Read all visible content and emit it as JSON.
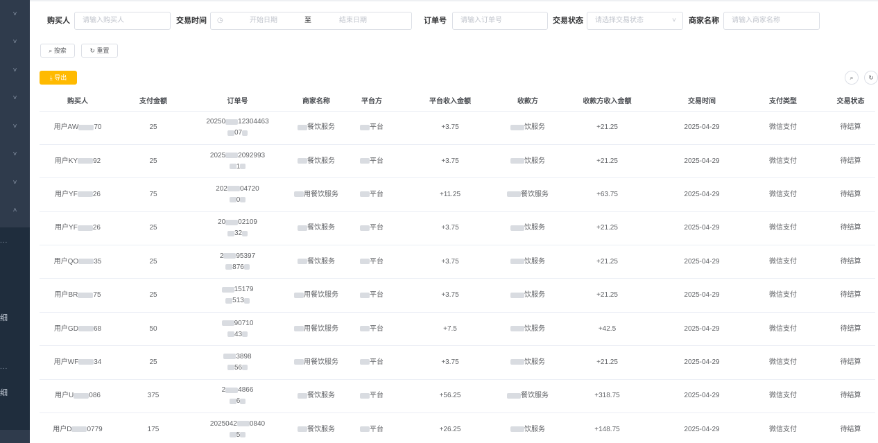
{
  "sidebar": {
    "chevron": "˅",
    "chevron_up": "˄",
    "dots": "...",
    "label_a": "细",
    "label_b": "细"
  },
  "filters": {
    "buyer_label": "购买人",
    "buyer_placeholder": "请输入购买人",
    "time_label": "交易时间",
    "start_placeholder": "开始日期",
    "range_sep": "至",
    "end_placeholder": "结束日期",
    "order_label": "订单号",
    "order_placeholder": "请输入订单号",
    "status_label": "交易状态",
    "status_placeholder": "请选择交易状态",
    "merchant_label": "商家名称",
    "merchant_placeholder": "请输入商家名称"
  },
  "actions": {
    "search": "搜索",
    "reset": "重置",
    "export": "导出"
  },
  "table": {
    "columns": [
      "购买人",
      "支付金额",
      "订单号",
      "商家名称",
      "平台方",
      "平台收入金额",
      "收款方",
      "收款方收入金额",
      "交易时间",
      "支付类型",
      "交易状态"
    ],
    "rows": [
      {
        "buyer_a": "用户AW",
        "buyer_b": "70",
        "amount": "25",
        "order_a": "20250",
        "order_b": "12304463",
        "order_c": "07",
        "merchant": "餐饮服务",
        "platform_a": "",
        "platform_b": "平台",
        "platform_income": "+3.75",
        "payee": "饮服务",
        "payee_income": "+21.25",
        "time": "2025-04-29",
        "pay_type": "微信支付",
        "status": "待结算"
      },
      {
        "buyer_a": "用户KY",
        "buyer_b": "92",
        "amount": "25",
        "order_a": "2025",
        "order_b": "2092993",
        "order_c": "1",
        "merchant": "餐饮服务",
        "platform_a": "",
        "platform_b": "平台",
        "platform_income": "+3.75",
        "payee": "饮服务",
        "payee_income": "+21.25",
        "time": "2025-04-29",
        "pay_type": "微信支付",
        "status": "待结算"
      },
      {
        "buyer_a": "用户YF",
        "buyer_b": "26",
        "amount": "75",
        "order_a": "202",
        "order_b": "04720",
        "order_c": "0",
        "merchant": "用餐饮服务",
        "platform_a": "",
        "platform_b": "平台",
        "platform_income": "+11.25",
        "payee": "餐饮服务",
        "payee_income": "+63.75",
        "time": "2025-04-29",
        "pay_type": "微信支付",
        "status": "待结算"
      },
      {
        "buyer_a": "用户YF",
        "buyer_b": "26",
        "amount": "25",
        "order_a": "20",
        "order_b": "02109",
        "order_c": "32",
        "merchant": "餐饮服务",
        "platform_a": "",
        "platform_b": "平台",
        "platform_income": "+3.75",
        "payee": "饮服务",
        "payee_income": "+21.25",
        "time": "2025-04-29",
        "pay_type": "微信支付",
        "status": "待结算"
      },
      {
        "buyer_a": "用户QO",
        "buyer_b": "35",
        "amount": "25",
        "order_a": "2",
        "order_b": "95397",
        "order_c": "876",
        "merchant": "餐饮服务",
        "platform_a": "",
        "platform_b": "平台",
        "platform_income": "+3.75",
        "payee": "饮服务",
        "payee_income": "+21.25",
        "time": "2025-04-29",
        "pay_type": "微信支付",
        "status": "待结算"
      },
      {
        "buyer_a": "用户BR",
        "buyer_b": "75",
        "amount": "25",
        "order_a": "",
        "order_b": "15179",
        "order_c": "513",
        "merchant": "用餐饮服务",
        "platform_a": "",
        "platform_b": "平台",
        "platform_income": "+3.75",
        "payee": "饮服务",
        "payee_income": "+21.25",
        "time": "2025-04-29",
        "pay_type": "微信支付",
        "status": "待结算"
      },
      {
        "buyer_a": "用户GD",
        "buyer_b": "68",
        "amount": "50",
        "order_a": "",
        "order_b": "90710",
        "order_c": "43",
        "merchant": "用餐饮服务",
        "platform_a": "",
        "platform_b": "平台",
        "platform_income": "+7.5",
        "payee": "饮服务",
        "payee_income": "+42.5",
        "time": "2025-04-29",
        "pay_type": "微信支付",
        "status": "待结算"
      },
      {
        "buyer_a": "用户WF",
        "buyer_b": "34",
        "amount": "25",
        "order_a": "",
        "order_b": "3898",
        "order_c": "56",
        "merchant": "用餐饮服务",
        "platform_a": "",
        "platform_b": "平台",
        "platform_income": "+3.75",
        "payee": "饮服务",
        "payee_income": "+21.25",
        "time": "2025-04-29",
        "pay_type": "微信支付",
        "status": "待结算"
      },
      {
        "buyer_a": "用户U",
        "buyer_b": "086",
        "amount": "375",
        "order_a": "2",
        "order_b": "4866",
        "order_c": "6",
        "merchant": "餐饮服务",
        "platform_a": "",
        "platform_b": "平台",
        "platform_income": "+56.25",
        "payee": "餐饮服务",
        "payee_income": "+318.75",
        "time": "2025-04-29",
        "pay_type": "微信支付",
        "status": "待结算"
      },
      {
        "buyer_a": "用户D",
        "buyer_b": "0779",
        "amount": "175",
        "order_a": "2025042",
        "order_b": "0840",
        "order_c": "5",
        "merchant": "餐饮服务",
        "platform_a": "",
        "platform_b": "平台",
        "platform_income": "+26.25",
        "payee": "饮服务",
        "payee_income": "+148.75",
        "time": "2025-04-29",
        "pay_type": "微信支付",
        "status": "待结算"
      }
    ]
  }
}
